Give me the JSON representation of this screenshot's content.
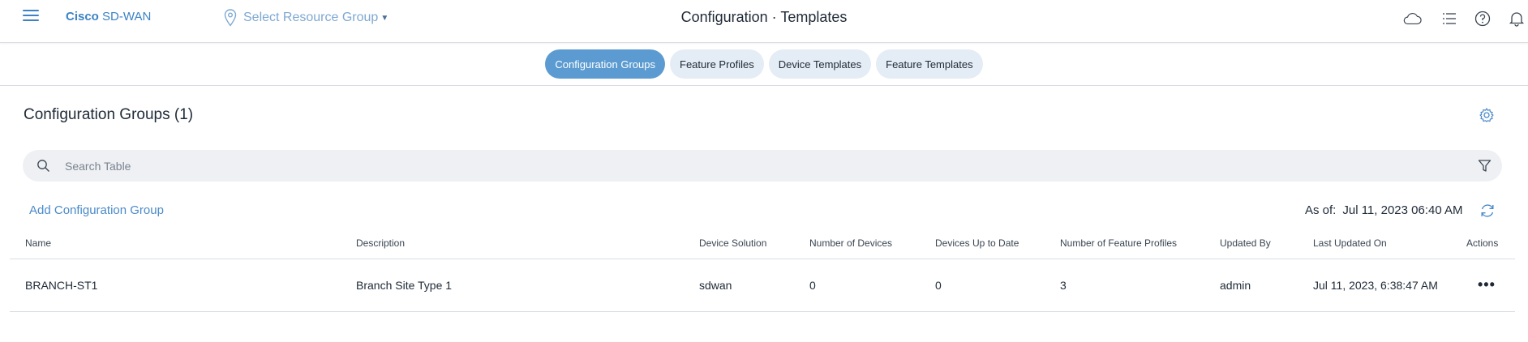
{
  "header": {
    "brand_bold": "Cisco",
    "brand_rest": "SD-WAN",
    "resource_label": "Select Resource Group",
    "title": "Configuration · Templates",
    "icons": [
      "menu-icon",
      "location-pin-icon",
      "chevron-down-icon",
      "cloud-icon",
      "list-icon",
      "help-icon",
      "bell-icon"
    ]
  },
  "tabs": [
    {
      "label": "Configuration Groups",
      "active": true
    },
    {
      "label": "Feature Profiles",
      "active": false
    },
    {
      "label": "Device Templates",
      "active": false
    },
    {
      "label": "Feature Templates",
      "active": false
    }
  ],
  "section": {
    "title": "Configuration Groups (1)",
    "search_placeholder": "Search Table",
    "add_label": "Add Configuration Group",
    "as_of_label": "As of:",
    "as_of_value": "Jul 11, 2023 06:40 AM"
  },
  "table": {
    "columns": [
      "Name",
      "Description",
      "Device Solution",
      "Number of Devices",
      "Devices Up to Date",
      "Number of Feature Profiles",
      "Updated By",
      "Last Updated On",
      "Actions"
    ],
    "rows": [
      {
        "name": "BRANCH-ST1",
        "description": "Branch Site Type 1",
        "device_solution": "sdwan",
        "number_of_devices": "0",
        "devices_up_to_date": "0",
        "number_of_feature_profiles": "3",
        "updated_by": "admin",
        "last_updated_on": "Jul 11, 2023, 6:38:47 AM",
        "actions": "•••"
      }
    ]
  },
  "colors": {
    "accent": "#3c82c4",
    "active_tab": "#5b9bd1",
    "inactive_tab": "#e4ecf5",
    "search_bg": "#eef0f3"
  }
}
